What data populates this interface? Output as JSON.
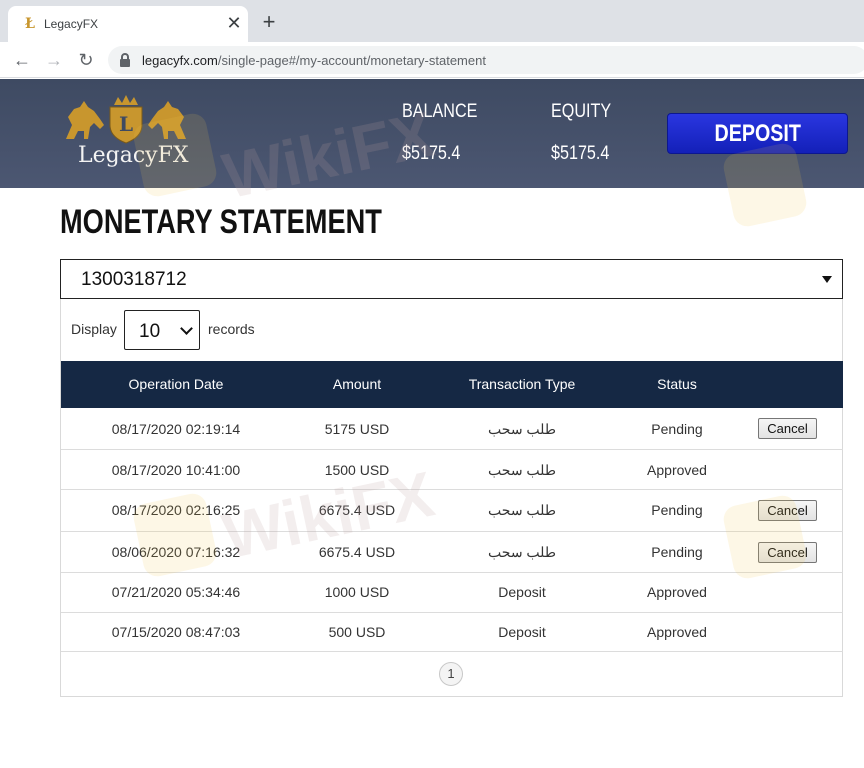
{
  "browser": {
    "tab_title": "LegacyFX",
    "tab_favicon": "Ł",
    "close_glyph": "✕",
    "new_tab_glyph": "+",
    "back_glyph": "←",
    "forward_glyph": "→",
    "reload_glyph": "↻",
    "url_host": "legacyfx.com",
    "url_path": "/single-page#/my-account/monetary-statement"
  },
  "header": {
    "logo_text": "LegacyFX",
    "balance_label": "BALANCE",
    "balance_value": "$5175.4",
    "equity_label": "EQUITY",
    "equity_value": "$5175.4",
    "deposit_label": "DEPOSIT"
  },
  "page": {
    "title": "MONETARY STATEMENT",
    "account_selected": "1300318712",
    "display_label": "Display",
    "records_per_page": "10",
    "records_label": "records"
  },
  "table": {
    "headers": [
      "Operation Date",
      "Amount",
      "Transaction Type",
      "Status"
    ],
    "rows": [
      {
        "date": "08/17/2020 02:19:14",
        "amount": "5175 USD",
        "type": "طلب سحب",
        "status": "Pending",
        "action": "Cancel"
      },
      {
        "date": "08/17/2020 10:41:00",
        "amount": "1500 USD",
        "type": "طلب سحب",
        "status": "Approved",
        "action": ""
      },
      {
        "date": "08/17/2020 02:16:25",
        "amount": "6675.4 USD",
        "type": "طلب سحب",
        "status": "Pending",
        "action": "Cancel"
      },
      {
        "date": "08/06/2020 07:16:32",
        "amount": "6675.4 USD",
        "type": "طلب سحب",
        "status": "Pending",
        "action": "Cancel"
      },
      {
        "date": "07/21/2020 05:34:46",
        "amount": "1000 USD",
        "type": "Deposit",
        "status": "Approved",
        "action": ""
      },
      {
        "date": "07/15/2020 08:47:03",
        "amount": "500 USD",
        "type": "Deposit",
        "status": "Approved",
        "action": ""
      }
    ]
  },
  "pagination": {
    "current_page": "1"
  },
  "watermark": {
    "text": "WikiFX"
  },
  "colors": {
    "header_bg": "#46516b",
    "table_header_bg": "#152844",
    "deposit_button": "#1a28cc",
    "logo_gold": "#c8962e"
  }
}
